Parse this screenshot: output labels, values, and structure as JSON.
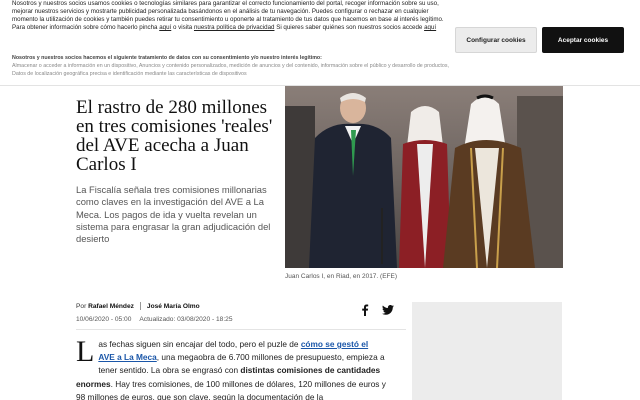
{
  "cookie_banner": {
    "paragraph_1": "Nosotros y nuestros socios usamos cookies o tecnologías similares para garantizar el correcto funcionamiento del portal, recoger información sobre su uso, mejorar nuestros servicios y mostrarte publicidad personalizada basándonos en el análisis de tu navegación. Puedes configurar o rechazar en cualquier momento la utilización de cookies y también puedes retirar tu consentimiento u oponerte al tratamiento de tus datos que hacemos en base al interés legítimo. Para obtener información sobre cómo hacerlo pincha ",
    "link_aqui_1": "aquí",
    "visita_text": " o visita ",
    "link_privacy": "nuestra política de privacidad",
    "know_text": " Si quieres saber quiénes son nuestros socios accede ",
    "link_aqui_2": "aquí",
    "legit_title": "Nosotros y nuestros socios hacemos el siguiente tratamiento de datos con su consentimiento y/o nuestro interés legítimo:",
    "legit_list": "Almacenar o acceder a información en un dispositivo, Anuncios y contenido personalizados, medición de anuncios y del contenido, información sobre el público y desarrollo de productos, Datos de localización geográfica precisa e identificación mediante las características de dispositivos",
    "configure_label": "Configurar cookies",
    "accept_label": "Aceptar cookies"
  },
  "article": {
    "headline": "El rastro de 280 millones en tres comisiones 'reales' del AVE acecha a Juan Carlos I",
    "standfirst": "La Fiscalía señala tres comisiones millonarias como claves en la investigación del AVE a La Meca. Los pagos de ida y vuelta revelan un sistema para engrasar la gran adjudicación del desierto",
    "photo_caption": "Juan Carlos I, en Riad, en 2017. (EFE)",
    "byline_prefix": "Por",
    "author_1": "Rafael Méndez",
    "author_2": "José María Olmo",
    "published": "10/06/2020 - 05:00",
    "updated": "Actualizado: 03/08/2020 - 18:25",
    "body": {
      "dropcap": "L",
      "t1": "as fechas siguen sin encajar del todo, pero el puzle de ",
      "link": "cómo se gestó el AVE a La Meca",
      "t2": ", una megaobra de 6.700 millones de presupuesto, empieza a tener sentido. La obra se engrasó con ",
      "bold": "distintas comisiones de cantidades enormes",
      "t3": ". Hay tres comisiones, de 100 millones de dólares, 120 millones de euros y 98 millones de euros, que son clave, según la documentación de la"
    }
  },
  "icons": {
    "facebook": "facebook-icon",
    "twitter": "twitter-icon"
  },
  "colors": {
    "accept_button": "#111111",
    "configure_button": "#ececec",
    "link": "#1a56a8"
  }
}
